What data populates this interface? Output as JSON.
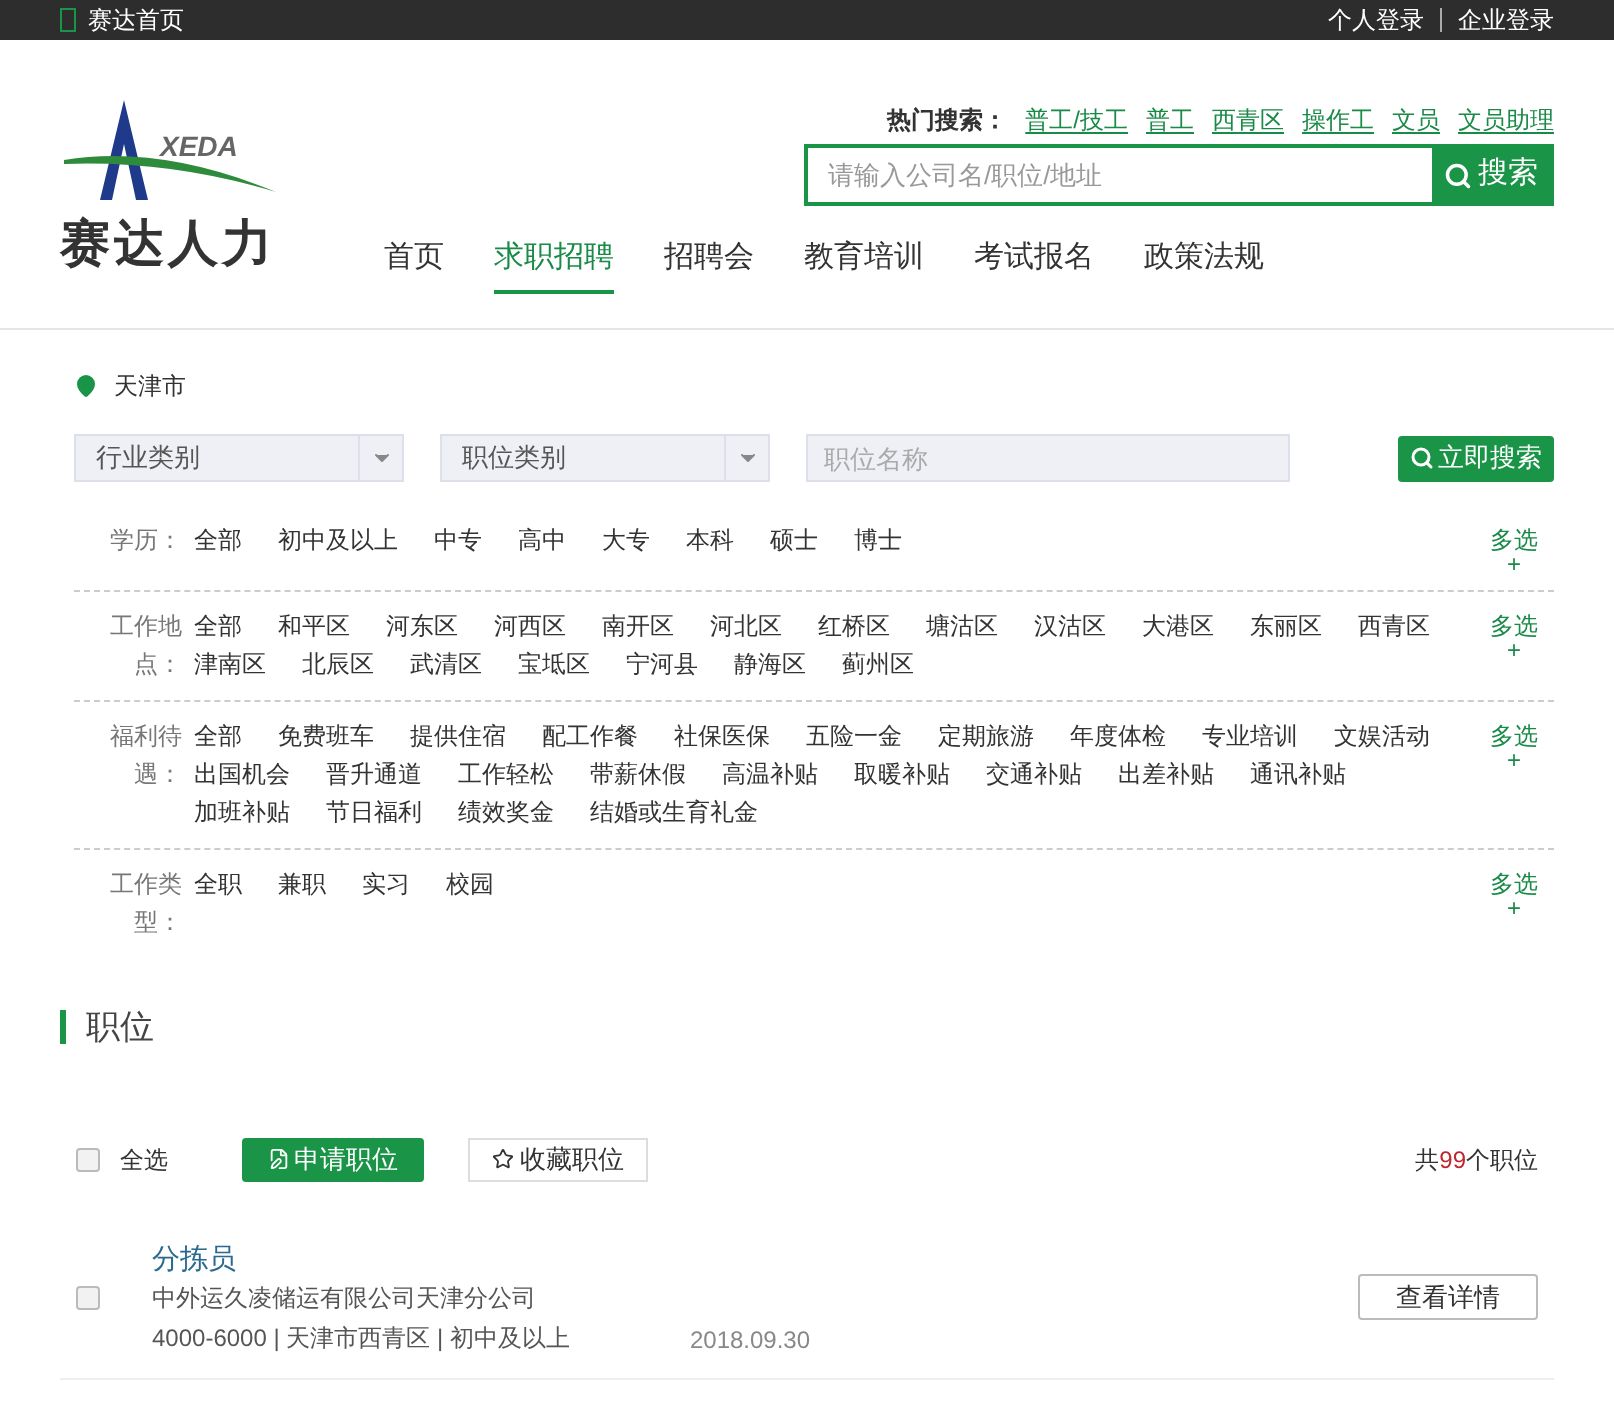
{
  "top_bar": {
    "home_link": "赛达首页",
    "links": [
      "个人登录",
      "企业登录"
    ]
  },
  "header": {
    "logo": {
      "mark_text": "XEDA",
      "name": "赛达人力"
    },
    "hot_search": {
      "label": "热门搜索：",
      "terms": [
        "普工/技工",
        "普工",
        "西青区",
        "操作工",
        "文员",
        "文员助理"
      ]
    },
    "search": {
      "placeholder": "请输入公司名/职位/地址",
      "button": "搜索"
    },
    "nav": [
      {
        "label": "首页",
        "selected": false
      },
      {
        "label": "求职招聘",
        "selected": true
      },
      {
        "label": "招聘会",
        "selected": false
      },
      {
        "label": "教育培训",
        "selected": false
      },
      {
        "label": "考试报名",
        "selected": false
      },
      {
        "label": "政策法规",
        "selected": false
      }
    ]
  },
  "filters": {
    "location": "天津市",
    "selects": [
      {
        "placeholder": "行业类别"
      },
      {
        "placeholder": "职位类别"
      }
    ],
    "keyword": {
      "placeholder": "职位名称"
    },
    "search_button": "立即搜索"
  },
  "criteria": [
    {
      "label": "学历：",
      "options": [
        "全部",
        "初中及以上",
        "中专",
        "高中",
        "大专",
        "本科",
        "硕士",
        "博士"
      ],
      "more": "多选",
      "more_mark": "+"
    },
    {
      "label": "工作地点：",
      "options": [
        "全部",
        "和平区",
        "河东区",
        "河西区",
        "南开区",
        "河北区",
        "红桥区",
        "塘沽区",
        "汉沽区",
        "大港区",
        "东丽区",
        "西青区",
        "津南区",
        "北辰区",
        "武清区",
        "宝坻区",
        "宁河县",
        "静海区",
        "蓟州区"
      ],
      "more": "多选",
      "more_mark": "+"
    },
    {
      "label": "福利待遇：",
      "options": [
        "全部",
        "免费班车",
        "提供住宿",
        "配工作餐",
        "社保医保",
        "五险一金",
        "定期旅游",
        "年度体检",
        "专业培训",
        "文娱活动",
        "出国机会",
        "晋升通道",
        "工作轻松",
        "带薪休假",
        "高温补贴",
        "取暖补贴",
        "交通补贴",
        "出差补贴",
        "通讯补贴",
        "加班补贴",
        "节日福利",
        "绩效奖金",
        "结婚或生育礼金"
      ],
      "more": "多选",
      "more_mark": "+"
    },
    {
      "label": "工作类型：",
      "options": [
        "全职",
        "兼职",
        "实习",
        "校园"
      ],
      "more": "多选",
      "more_mark": "+"
    }
  ],
  "jobs_section": {
    "title": "职位",
    "toolbar": {
      "select_all": {
        "label": "全选",
        "checked": false
      },
      "apply_button": "申请职位",
      "favorite_button": "收藏职位",
      "total_prefix": "共",
      "total_count": "99",
      "total_suffix": "个职位"
    },
    "jobs": [
      {
        "title": "分拣员",
        "company": "中外运久凌储运有限公司天津分公司",
        "details": "4000-6000 | 天津市西青区 | 初中及以上",
        "date": "2018.09.30",
        "button": "查看详情",
        "checked": false
      }
    ]
  }
}
